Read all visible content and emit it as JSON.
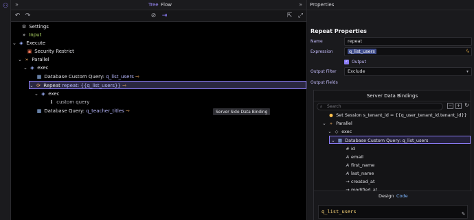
{
  "topbar": {
    "tab_tree": "Tree",
    "tab_flow": "Flow"
  },
  "tree": {
    "settings": "Settings",
    "input": "Input",
    "execute": "Execute",
    "security": "Security Restrict",
    "parallel": "Parallel",
    "exec1": "exec",
    "db_custom_label": "Database Custom Query:",
    "db_custom_ref": "q_list_users",
    "repeat_label": "Repeat",
    "repeat_ref": "repeat: {{q_list_users}}",
    "exec2": "exec",
    "custom_query": "custom query",
    "db_query_label": "Database Query:",
    "db_query_ref": "q_teacher_titles"
  },
  "tooltip": "Server Side Data Binding",
  "panel": {
    "header": "Properties",
    "title": "Repeat Properties",
    "name_label": "Name",
    "name_value": "repeat",
    "expression_label": "Expression",
    "expression_value": "q_list_users",
    "output_check_label": "Output",
    "output_filter_label": "Output Filter",
    "output_filter_value": "Exclude",
    "output_fields_label": "Output Fields"
  },
  "bindings": {
    "title": "Server Data Bindings",
    "search_placeholder": "Search",
    "items": [
      "Set Session s_tenant_id = {{q_user_tenant_id.tenant_id}}",
      "Parallel",
      "exec",
      "Database Custom Query: q_list_users",
      "id",
      "email",
      "first_name",
      "last_name",
      "created_at",
      "modified_at"
    ],
    "mode_design": "Design",
    "mode_code": "Code",
    "code_value": "q_list_users"
  },
  "colors": {
    "accent": "#8b7cf6",
    "highlight_ref": "#b9b9ff",
    "code_text": "#ffd97a"
  },
  "icons": [
    "undo-icon",
    "redo-icon",
    "disable-icon",
    "run-icon",
    "share-icon",
    "expand-icon",
    "gear-icon",
    "chevrons-icon",
    "cube-icon",
    "table-icon",
    "repeat-icon",
    "info-icon",
    "lock-icon",
    "hash-icon",
    "text-icon",
    "arrow-icon",
    "wand-icon"
  ]
}
